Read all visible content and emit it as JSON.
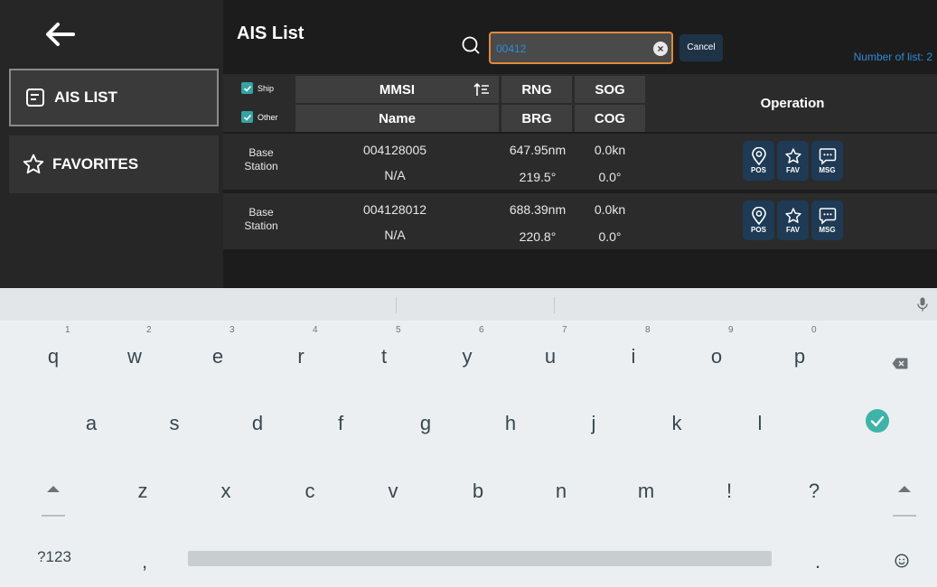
{
  "sidebar": {
    "items": [
      {
        "label": "AIS LIST",
        "icon": "list-icon"
      },
      {
        "label": "FAVORITES",
        "icon": "star-icon"
      }
    ]
  },
  "header": {
    "title": "AIS List",
    "search_value": "00412",
    "cancel_label": "Cancel",
    "count_text": "Number of list:  2"
  },
  "filters": [
    {
      "label": "Ship",
      "checked": true
    },
    {
      "label": "Other",
      "checked": true
    }
  ],
  "table": {
    "columns": {
      "mmsi": "MMSI",
      "name": "Name",
      "rng": "RNG",
      "brg": "BRG",
      "sog": "SOG",
      "cog": "COG",
      "operation": "Operation"
    },
    "rows": [
      {
        "type": "Base Station",
        "mmsi": "004128005",
        "name": "N/A",
        "rng": "647.95nm",
        "brg": "219.5°",
        "sog": "0.0kn",
        "cog": "0.0°"
      },
      {
        "type": "Base Station",
        "mmsi": "004128012",
        "name": "N/A",
        "rng": "688.39nm",
        "brg": "220.8°",
        "sog": "0.0kn",
        "cog": "0.0°"
      }
    ],
    "actions": [
      {
        "label": "POS",
        "icon": "location-pin-icon"
      },
      {
        "label": "FAV",
        "icon": "star-icon"
      },
      {
        "label": "MSG",
        "icon": "message-icon"
      }
    ]
  },
  "keyboard": {
    "row1": [
      "q",
      "w",
      "e",
      "r",
      "t",
      "y",
      "u",
      "i",
      "o",
      "p"
    ],
    "row1_hints": [
      "1",
      "2",
      "3",
      "4",
      "5",
      "6",
      "7",
      "8",
      "9",
      "0"
    ],
    "row2": [
      "a",
      "s",
      "d",
      "f",
      "g",
      "h",
      "j",
      "k",
      "l"
    ],
    "row3": [
      "z",
      "x",
      "c",
      "v",
      "b",
      "n",
      "m",
      "!",
      "?"
    ],
    "symbols_label": "?123",
    "comma": ",",
    "period": "."
  },
  "colors": {
    "accent_blue": "#2f8bd8",
    "search_border": "#e08a3a",
    "checkbox": "#35a3a3",
    "action_button": "#1e3a55",
    "enter_key": "#3eb3a8"
  }
}
